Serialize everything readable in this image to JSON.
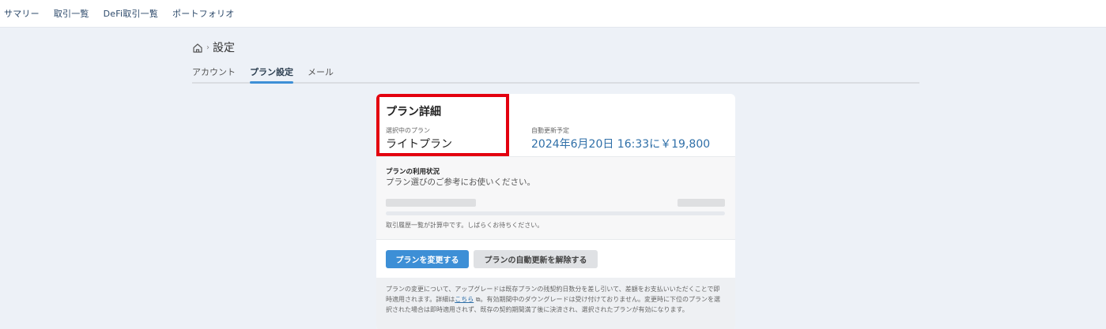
{
  "topnav": {
    "items": [
      "サマリー",
      "取引一覧",
      "DeFi取引一覧",
      "ポートフォリオ"
    ]
  },
  "breadcrumb": {
    "sep": "›",
    "title": "設定"
  },
  "tabs": [
    "アカウント",
    "プラン設定",
    "メール"
  ],
  "plan_detail": {
    "title": "プラン詳細",
    "current_plan_label": "選択中のプラン",
    "current_plan": "ライトプラン",
    "renewal_label": "自動更新予定",
    "renewal_value": "2024年6月20日 16:33に￥19,800"
  },
  "usage": {
    "title": "プランの利用状況",
    "description": "プラン選びのご参考にお使いください。",
    "note": "取引履歴一覧が計算中です。しばらくお待ちください。"
  },
  "actions": {
    "change_plan": "プランを変更する",
    "cancel_renewal": "プランの自動更新を解除する"
  },
  "notes": {
    "before_link": "プランの変更について、アップグレードは既存プランの残契約日数分を差し引いて、差額をお支払いいただくことで即時適用されます。詳細は",
    "link": "こちら",
    "link_icon": "⧉",
    "after_link": "。有効期間中のダウングレードは受け付けておりません。変更時に下位のプランを選択された場合は即時適用されず、既存の契約期間満了後に決済され、選択されたプランが有効になります。"
  },
  "colors": {
    "accent": "#3d8fd6",
    "highlight": "#e3000f",
    "renewal_text": "#2f6fa8"
  }
}
